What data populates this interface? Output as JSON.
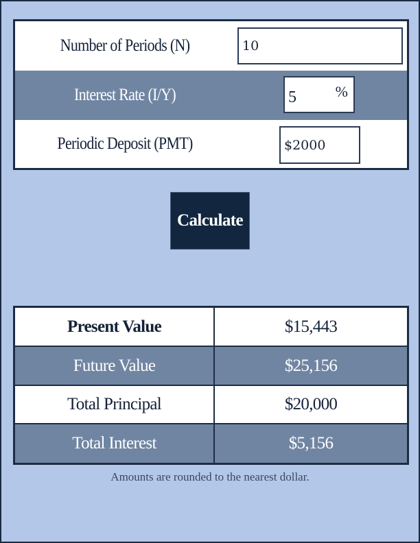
{
  "inputs": {
    "periods": {
      "label": "Number of Periods (N)",
      "value": "10"
    },
    "interest_rate": {
      "label": "Interest Rate (I/Y)",
      "value": "5",
      "suffix": "%"
    },
    "periodic_deposit": {
      "label": "Periodic Deposit (PMT)",
      "value": "$2000"
    }
  },
  "actions": {
    "calculate_label": "Calculate"
  },
  "results": [
    {
      "label": "Present Value",
      "value": "$15,443"
    },
    {
      "label": "Future Value",
      "value": "$25,156"
    },
    {
      "label": "Total Principal",
      "value": "$20,000"
    },
    {
      "label": "Total Interest",
      "value": "$5,156"
    }
  ],
  "note": "Amounts are rounded to the nearest dollar.",
  "colors": {
    "background": "#b3c8e8",
    "navy": "#12263f",
    "row_blue": "#7085a2",
    "border": "#1d2c44"
  }
}
